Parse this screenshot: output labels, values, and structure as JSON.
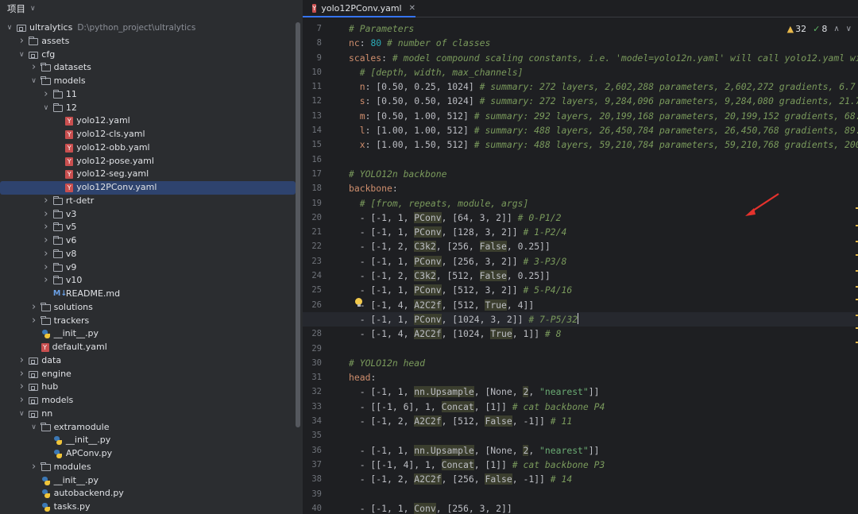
{
  "project_panel": {
    "title": "项目",
    "tree": [
      {
        "depth": 0,
        "type": "module",
        "name": "ultralytics",
        "hint": "D:\\python_project\\ultralytics",
        "expanded": true
      },
      {
        "depth": 1,
        "type": "folder",
        "name": "assets",
        "expanded": false
      },
      {
        "depth": 1,
        "type": "module",
        "name": "cfg",
        "expanded": true
      },
      {
        "depth": 2,
        "type": "folder",
        "name": "datasets",
        "expanded": false
      },
      {
        "depth": 2,
        "type": "folder",
        "name": "models",
        "expanded": true
      },
      {
        "depth": 3,
        "type": "folder",
        "name": "11",
        "expanded": false
      },
      {
        "depth": 3,
        "type": "folder",
        "name": "12",
        "expanded": true
      },
      {
        "depth": 4,
        "type": "yaml",
        "name": "yolo12.yaml"
      },
      {
        "depth": 4,
        "type": "yaml",
        "name": "yolo12-cls.yaml"
      },
      {
        "depth": 4,
        "type": "yaml",
        "name": "yolo12-obb.yaml"
      },
      {
        "depth": 4,
        "type": "yaml",
        "name": "yolo12-pose.yaml"
      },
      {
        "depth": 4,
        "type": "yaml",
        "name": "yolo12-seg.yaml"
      },
      {
        "depth": 4,
        "type": "yaml",
        "name": "yolo12PConv.yaml",
        "selected": true
      },
      {
        "depth": 3,
        "type": "folder",
        "name": "rt-detr",
        "expanded": false
      },
      {
        "depth": 3,
        "type": "folder",
        "name": "v3",
        "expanded": false
      },
      {
        "depth": 3,
        "type": "folder",
        "name": "v5",
        "expanded": false
      },
      {
        "depth": 3,
        "type": "folder",
        "name": "v6",
        "expanded": false
      },
      {
        "depth": 3,
        "type": "folder",
        "name": "v8",
        "expanded": false
      },
      {
        "depth": 3,
        "type": "folder",
        "name": "v9",
        "expanded": false
      },
      {
        "depth": 3,
        "type": "folder",
        "name": "v10",
        "expanded": false
      },
      {
        "depth": 3,
        "type": "md",
        "name": "README.md"
      },
      {
        "depth": 2,
        "type": "folder",
        "name": "solutions",
        "expanded": false
      },
      {
        "depth": 2,
        "type": "folder",
        "name": "trackers",
        "expanded": false
      },
      {
        "depth": 2,
        "type": "py",
        "name": "__init__.py"
      },
      {
        "depth": 2,
        "type": "yaml",
        "name": "default.yaml"
      },
      {
        "depth": 1,
        "type": "module",
        "name": "data",
        "expanded": false
      },
      {
        "depth": 1,
        "type": "module",
        "name": "engine",
        "expanded": false
      },
      {
        "depth": 1,
        "type": "module",
        "name": "hub",
        "expanded": false
      },
      {
        "depth": 1,
        "type": "module",
        "name": "models",
        "expanded": false
      },
      {
        "depth": 1,
        "type": "module",
        "name": "nn",
        "expanded": true
      },
      {
        "depth": 2,
        "type": "folder",
        "name": "extramodule",
        "expanded": true
      },
      {
        "depth": 3,
        "type": "py",
        "name": "__init__.py"
      },
      {
        "depth": 3,
        "type": "py",
        "name": "APConv.py"
      },
      {
        "depth": 2,
        "type": "folder",
        "name": "modules",
        "expanded": false
      },
      {
        "depth": 2,
        "type": "py",
        "name": "__init__.py"
      },
      {
        "depth": 2,
        "type": "py",
        "name": "autobackend.py"
      },
      {
        "depth": 2,
        "type": "py",
        "name": "tasks.py"
      }
    ]
  },
  "editor": {
    "tab_label": "yolo12PConv.yaml",
    "tab_icon": "Y",
    "inspections": {
      "warnings": "32",
      "ok": "8"
    },
    "current_line": 27,
    "lines": [
      {
        "n": 7,
        "segs": [
          [
            "c",
            "# Parameters"
          ]
        ]
      },
      {
        "n": 8,
        "segs": [
          [
            "k",
            "nc"
          ],
          [
            "p",
            ": "
          ],
          [
            "n",
            "80"
          ],
          [
            "p",
            " "
          ],
          [
            "c",
            "# number of classes"
          ]
        ]
      },
      {
        "n": 9,
        "segs": [
          [
            "k",
            "scales"
          ],
          [
            "p",
            ": "
          ],
          [
            "c",
            "# model compound scaling constants, i.e. 'model=yolo12n.yaml' will call yolo12.yaml with"
          ]
        ]
      },
      {
        "n": 10,
        "segs": [
          [
            "p",
            "  "
          ],
          [
            "c",
            "# [depth, width, max_channels]"
          ]
        ]
      },
      {
        "n": 11,
        "segs": [
          [
            "p",
            "  "
          ],
          [
            "k",
            "n"
          ],
          [
            "p",
            ": [0.50, 0.25, 1024] "
          ],
          [
            "c",
            "# summary: 272 layers, 2,602,288 parameters, 2,602,272 gradients, 6.7 GF"
          ]
        ]
      },
      {
        "n": 12,
        "segs": [
          [
            "p",
            "  "
          ],
          [
            "k",
            "s"
          ],
          [
            "p",
            ": [0.50, 0.50, 1024] "
          ],
          [
            "c",
            "# summary: 272 layers, 9,284,096 parameters, 9,284,080 gradients, 21.7 G"
          ]
        ]
      },
      {
        "n": 13,
        "segs": [
          [
            "p",
            "  "
          ],
          [
            "k",
            "m"
          ],
          [
            "p",
            ": [0.50, 1.00, 512] "
          ],
          [
            "c",
            "# summary: 292 layers, 20,199,168 parameters, 20,199,152 gradients, 68.1"
          ]
        ]
      },
      {
        "n": 14,
        "segs": [
          [
            "p",
            "  "
          ],
          [
            "k",
            "l"
          ],
          [
            "p",
            ": [1.00, 1.00, 512] "
          ],
          [
            "c",
            "# summary: 488 layers, 26,450,784 parameters, 26,450,768 gradients, 89.7"
          ]
        ]
      },
      {
        "n": 15,
        "segs": [
          [
            "p",
            "  "
          ],
          [
            "k",
            "x"
          ],
          [
            "p",
            ": [1.00, 1.50, 512] "
          ],
          [
            "c",
            "# summary: 488 layers, 59,210,784 parameters, 59,210,768 gradients, 200.3"
          ]
        ]
      },
      {
        "n": 16,
        "segs": []
      },
      {
        "n": 17,
        "segs": [
          [
            "c",
            "# YOLO12n backbone"
          ]
        ]
      },
      {
        "n": 18,
        "segs": [
          [
            "k",
            "backbone"
          ],
          [
            "p",
            ":"
          ]
        ]
      },
      {
        "n": 19,
        "segs": [
          [
            "p",
            "  "
          ],
          [
            "c",
            "# [from, repeats, module, args]"
          ]
        ]
      },
      {
        "n": 20,
        "segs": [
          [
            "p",
            "  - [-1, 1, "
          ],
          [
            "h",
            "PConv"
          ],
          [
            "p",
            ", [64, 3, 2]] "
          ],
          [
            "c",
            "# 0-P1/2"
          ]
        ]
      },
      {
        "n": 21,
        "segs": [
          [
            "p",
            "  - [-1, 1, "
          ],
          [
            "h",
            "PConv"
          ],
          [
            "p",
            ", [128, 3, 2]] "
          ],
          [
            "c",
            "# 1-P2/4"
          ]
        ]
      },
      {
        "n": 22,
        "segs": [
          [
            "p",
            "  - [-1, 2, "
          ],
          [
            "h",
            "C3k2"
          ],
          [
            "p",
            ", [256, "
          ],
          [
            "h",
            "False"
          ],
          [
            "p",
            ", 0.25]]"
          ]
        ]
      },
      {
        "n": 23,
        "segs": [
          [
            "p",
            "  - [-1, 1, "
          ],
          [
            "h",
            "PConv"
          ],
          [
            "p",
            ", [256, 3, 2]] "
          ],
          [
            "c",
            "# 3-P3/8"
          ]
        ]
      },
      {
        "n": 24,
        "segs": [
          [
            "p",
            "  - [-1, 2, "
          ],
          [
            "h",
            "C3k2"
          ],
          [
            "p",
            ", [512, "
          ],
          [
            "h",
            "False"
          ],
          [
            "p",
            ", 0.25]]"
          ]
        ]
      },
      {
        "n": 25,
        "segs": [
          [
            "p",
            "  - [-1, 1, "
          ],
          [
            "h",
            "PConv"
          ],
          [
            "p",
            ", [512, 3, 2]] "
          ],
          [
            "c",
            "# 5-P4/16"
          ]
        ]
      },
      {
        "n": 26,
        "segs": [
          [
            "p",
            "  - [-1, 4, "
          ],
          [
            "h",
            "A2C2f"
          ],
          [
            "p",
            ", [512, "
          ],
          [
            "h",
            "True"
          ],
          [
            "p",
            ", 4]]"
          ]
        ]
      },
      {
        "n": 27,
        "segs": [
          [
            "p",
            "  - [-1, 1, "
          ],
          [
            "h",
            "PConv"
          ],
          [
            "p",
            ", [1024, 3, 2]] "
          ],
          [
            "c",
            "# 7-P5/32"
          ]
        ]
      },
      {
        "n": 28,
        "segs": [
          [
            "p",
            "  - [-1, 4, "
          ],
          [
            "h",
            "A2C2f"
          ],
          [
            "p",
            ", [1024, "
          ],
          [
            "h",
            "True"
          ],
          [
            "p",
            ", 1]] "
          ],
          [
            "c",
            "# 8"
          ]
        ]
      },
      {
        "n": 29,
        "segs": []
      },
      {
        "n": 30,
        "segs": [
          [
            "c",
            "# YOLO12n head"
          ]
        ]
      },
      {
        "n": 31,
        "segs": [
          [
            "k",
            "head"
          ],
          [
            "p",
            ":"
          ]
        ]
      },
      {
        "n": 32,
        "segs": [
          [
            "p",
            "  - [-1, 1, "
          ],
          [
            "h",
            "nn.Upsample"
          ],
          [
            "p",
            ", [None, "
          ],
          [
            "h",
            "2"
          ],
          [
            "p",
            ", "
          ],
          [
            "s",
            "\"nearest\""
          ],
          [
            "p",
            "]]"
          ]
        ]
      },
      {
        "n": 33,
        "segs": [
          [
            "p",
            "  - [[-1, 6], 1, "
          ],
          [
            "h",
            "Concat"
          ],
          [
            "p",
            ", [1]] "
          ],
          [
            "c",
            "# cat backbone P4"
          ]
        ]
      },
      {
        "n": 34,
        "segs": [
          [
            "p",
            "  - [-1, 2, "
          ],
          [
            "h",
            "A2C2f"
          ],
          [
            "p",
            ", [512, "
          ],
          [
            "h",
            "False"
          ],
          [
            "p",
            ", -1]] "
          ],
          [
            "c",
            "# 11"
          ]
        ]
      },
      {
        "n": 35,
        "segs": []
      },
      {
        "n": 36,
        "segs": [
          [
            "p",
            "  - [-1, 1, "
          ],
          [
            "h",
            "nn.Upsample"
          ],
          [
            "p",
            ", [None, "
          ],
          [
            "h",
            "2"
          ],
          [
            "p",
            ", "
          ],
          [
            "s",
            "\"nearest\""
          ],
          [
            "p",
            "]]"
          ]
        ]
      },
      {
        "n": 37,
        "segs": [
          [
            "p",
            "  - [[-1, 4], 1, "
          ],
          [
            "h",
            "Concat"
          ],
          [
            "p",
            ", [1]] "
          ],
          [
            "c",
            "# cat backbone P3"
          ]
        ]
      },
      {
        "n": 38,
        "segs": [
          [
            "p",
            "  - [-1, 2, "
          ],
          [
            "h",
            "A2C2f"
          ],
          [
            "p",
            ", [256, "
          ],
          [
            "h",
            "False"
          ],
          [
            "p",
            ", -1]] "
          ],
          [
            "c",
            "# 14"
          ]
        ]
      },
      {
        "n": 39,
        "segs": []
      },
      {
        "n": 40,
        "segs": [
          [
            "p",
            "  - [-1, 1, "
          ],
          [
            "h",
            "Conv"
          ],
          [
            "p",
            ", [256, 3, 2]]"
          ]
        ]
      }
    ]
  }
}
